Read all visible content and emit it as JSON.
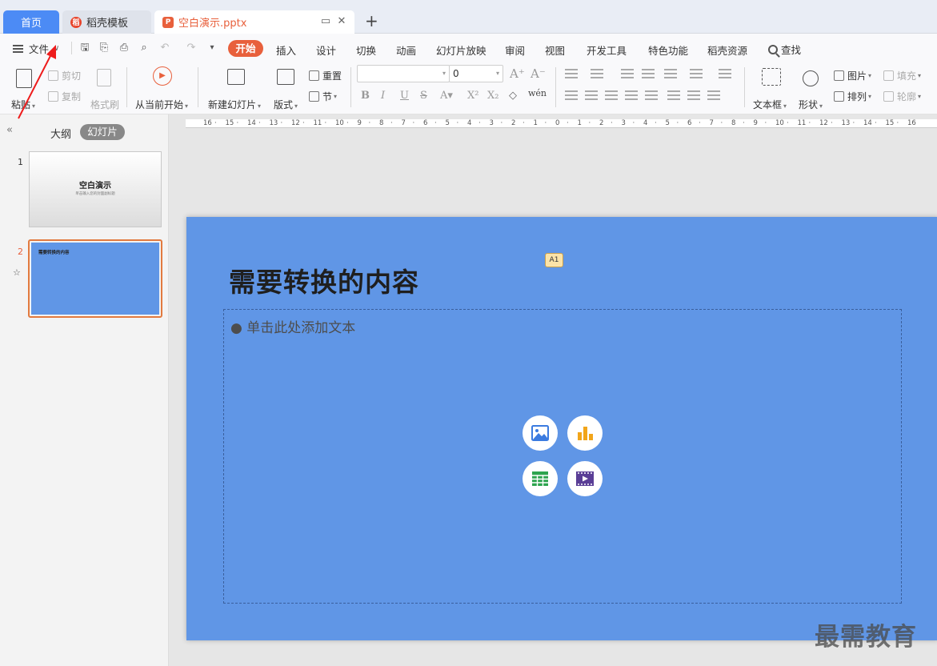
{
  "tabs": {
    "home": "首页",
    "template": "稻壳模板",
    "document": "空白演示.pptx",
    "new_tab": "+"
  },
  "menu": {
    "file": "文件",
    "items": [
      "开始",
      "插入",
      "设计",
      "切换",
      "动画",
      "幻灯片放映",
      "审阅",
      "视图",
      "开发工具",
      "特色功能",
      "稻壳资源"
    ],
    "search": "查找"
  },
  "ribbon": {
    "paste": "粘贴",
    "cut": "剪切",
    "copy": "复制",
    "format_painter": "格式刷",
    "play_from_current": "从当前开始",
    "new_slide": "新建幻灯片",
    "layout": "版式",
    "reset": "重置",
    "section": "节",
    "font_name": "",
    "font_size": "0",
    "textbox": "文本框",
    "shape": "形状",
    "picture": "图片",
    "fill": "填充",
    "arrange": "排列",
    "outline": "轮廓"
  },
  "panel": {
    "collapse": "«",
    "outline_tab": "大纲",
    "slides_tab": "幻灯片",
    "slides": [
      {
        "number": "1",
        "title": "空白演示",
        "subtitle": "单击输入您的封面副标题"
      },
      {
        "number": "2",
        "title": "需要转换的内容"
      }
    ]
  },
  "ruler": {
    "labels": [
      "16",
      "15",
      "14",
      "13",
      "12",
      "11",
      "10",
      "9",
      "8",
      "7",
      "6",
      "5",
      "4",
      "3",
      "2",
      "1",
      "0",
      "1",
      "2",
      "3",
      "4",
      "5",
      "6",
      "7",
      "8",
      "9",
      "10",
      "11",
      "12",
      "13",
      "14",
      "15",
      "16"
    ]
  },
  "slide": {
    "title": "需要转换的内容",
    "comment_marker": "A1",
    "placeholder": "● 单击此处添加文本",
    "background_color": "#6096e6"
  },
  "insert_icons": [
    "picture-icon",
    "chart-icon",
    "table-icon",
    "video-icon"
  ],
  "watermark": "最需教育",
  "colors": {
    "accent": "#e8603c",
    "home_tab": "#4c8bf5",
    "selection": "#e27a3f"
  }
}
